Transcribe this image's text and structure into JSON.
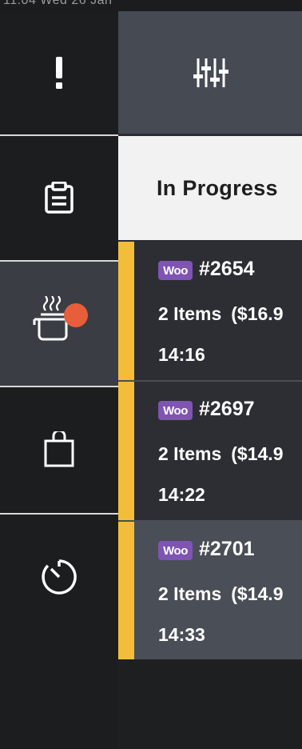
{
  "status_bar": {
    "text": "11:04 Wed 26 Jan"
  },
  "sidebar": {
    "items": [
      {
        "icon": "exclamation-icon",
        "active": false
      },
      {
        "icon": "clipboard-icon",
        "active": false
      },
      {
        "icon": "cooking-pot-icon",
        "active": true,
        "badge_color": "#e85d3a"
      },
      {
        "icon": "shopping-bag-icon",
        "active": false
      },
      {
        "icon": "timer-icon",
        "active": false
      }
    ]
  },
  "header": {
    "filter_icon": "sliders-icon"
  },
  "tabs": {
    "active_label": "In Progress"
  },
  "orders": [
    {
      "source": "Woo",
      "number": "#2654",
      "items": "2 Items",
      "price": "($16.9",
      "time": "14:16"
    },
    {
      "source": "Woo",
      "number": "#2697",
      "items": "2 Items",
      "price": "($14.9",
      "time": "14:22"
    },
    {
      "source": "Woo",
      "number": "#2701",
      "items": "2 Items",
      "price": "($14.9",
      "time": "14:33"
    }
  ],
  "colors": {
    "accent": "#f3bd3a",
    "woo_badge": "#7f54b3",
    "notification": "#e85d3a"
  }
}
